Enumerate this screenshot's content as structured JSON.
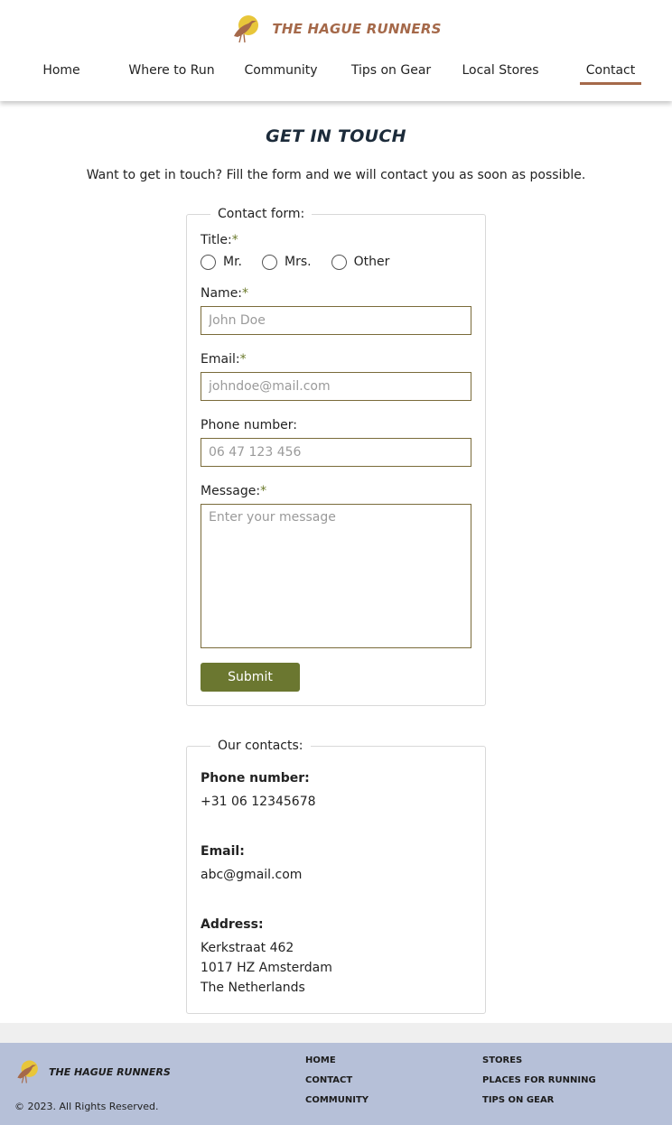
{
  "brand": {
    "name": "THE HAGUE RUNNERS",
    "logo_icon": "heron-sun-logo-icon"
  },
  "colors": {
    "accent": "#a5694a",
    "olive": "#6b7730",
    "footer_bg": "#b6c0d8",
    "title": "#1c2b3a"
  },
  "nav": {
    "items": [
      {
        "label": "Home"
      },
      {
        "label": "Where to Run"
      },
      {
        "label": "Community"
      },
      {
        "label": "Tips on Gear"
      },
      {
        "label": "Local Stores"
      },
      {
        "label": "Contact",
        "active": true
      }
    ]
  },
  "main": {
    "title": "GET IN TOUCH",
    "intro": "Want to get in touch? Fill the form and we will contact you as soon as possible."
  },
  "form": {
    "legend": "Contact form:",
    "required_mark": "*",
    "title_label": "Title:",
    "title_options": [
      "Mr.",
      "Mrs.",
      "Other"
    ],
    "name_label": "Name:",
    "name_placeholder": "John Doe",
    "email_label": "Email:",
    "email_placeholder": "johndoe@mail.com",
    "phone_label": "Phone number:",
    "phone_placeholder": "06 47 123 456",
    "message_label": "Message:",
    "message_placeholder": "Enter your message",
    "submit_label": "Submit"
  },
  "contacts": {
    "legend": "Our contacts:",
    "phone_label": "Phone number:",
    "phone_value": "+31 06 12345678",
    "email_label": "Email:",
    "email_value": "abc@gmail.com",
    "address_label": "Address:",
    "address_lines": [
      "Kerkstraat 462",
      "1017 HZ Amsterdam",
      "The Netherlands"
    ]
  },
  "footer": {
    "brand_name": "THE HAGUE RUNNERS",
    "copyright": "© 2023. All Rights Reserved.",
    "links_col1": [
      "HOME",
      "CONTACT",
      "COMMUNITY"
    ],
    "links_col2": [
      "STORES",
      "PLACES FOR RUNNING",
      "TIPS ON GEAR"
    ]
  }
}
